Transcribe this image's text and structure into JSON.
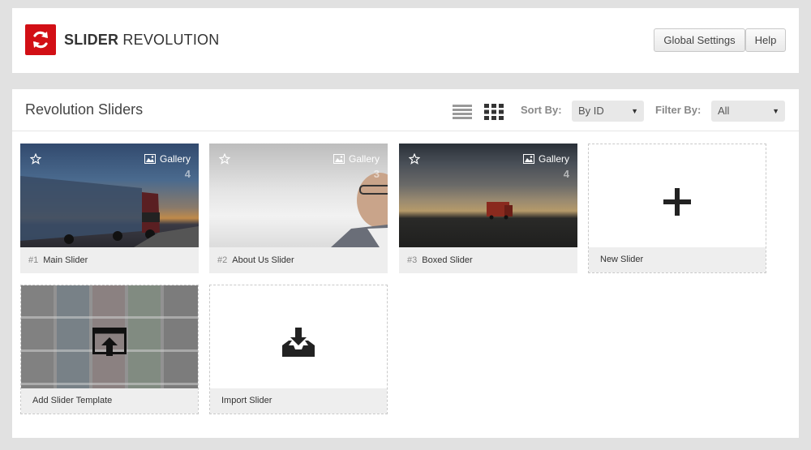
{
  "header": {
    "brand_bold": "SLIDER",
    "brand_light": "REVOLUTION",
    "global_settings_label": "Global Settings",
    "help_label": "Help"
  },
  "main": {
    "title": "Revolution Sliders",
    "sort_label": "Sort By:",
    "sort_value": "By ID",
    "filter_label": "Filter By:",
    "filter_value": "All"
  },
  "sliders": [
    {
      "id": "#1",
      "name": "Main Slider",
      "type": "Gallery",
      "count": "4"
    },
    {
      "id": "#2",
      "name": "About Us Slider",
      "type": "Gallery",
      "count": "3"
    },
    {
      "id": "#3",
      "name": "Boxed Slider",
      "type": "Gallery",
      "count": "4"
    }
  ],
  "actions": {
    "new_slider": "New Slider",
    "add_template": "Add Slider Template",
    "import_slider": "Import Slider"
  },
  "colors": {
    "brand_red": "#d20f15",
    "panel_bg": "#ffffff",
    "page_bg": "#e1e1e1"
  }
}
